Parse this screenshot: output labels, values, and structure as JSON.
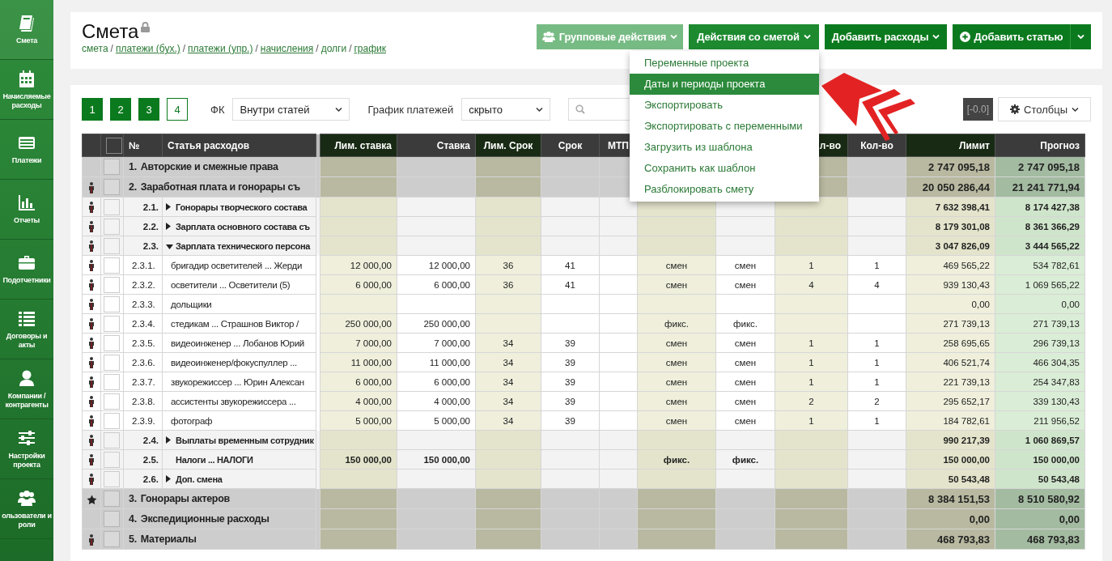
{
  "sidebar": {
    "items": [
      {
        "label": "Смета",
        "selected": true
      },
      {
        "label": "Начисляемые расходы",
        "selected": false
      },
      {
        "label": "Платежи",
        "selected": false
      },
      {
        "label": "Отчеты",
        "selected": false
      },
      {
        "label": "Подотчетники",
        "selected": false
      },
      {
        "label": "Договоры и акты",
        "selected": false
      },
      {
        "label": "Компании / контрагенты",
        "selected": false
      },
      {
        "label": "Настройки проекта",
        "selected": false
      },
      {
        "label": "ользователи и роли",
        "selected": false
      }
    ]
  },
  "header": {
    "title": "Смета",
    "locked": true,
    "breadcrumb": [
      {
        "kind": "crumb",
        "label": "смета",
        "link": false
      },
      {
        "kind": "separator",
        "label": "/"
      },
      {
        "kind": "crumb",
        "label": "платежи (бух.)",
        "link": true
      },
      {
        "kind": "separator",
        "label": "/"
      },
      {
        "kind": "crumb",
        "label": "платежи (упр.)",
        "link": true
      },
      {
        "kind": "separator",
        "label": "/"
      },
      {
        "kind": "crumb",
        "label": "начисления",
        "link": true
      },
      {
        "kind": "separator",
        "label": "/"
      },
      {
        "kind": "crumb",
        "label": "долги",
        "link": false
      },
      {
        "kind": "separator",
        "label": "/"
      },
      {
        "kind": "crumb",
        "label": "график",
        "link": true
      }
    ],
    "buttons": [
      {
        "label": "Групповые действия",
        "disabled": true,
        "open": false
      },
      {
        "label": "Действия со сметой",
        "disabled": false,
        "open": true
      },
      {
        "label": "Добавить расходы",
        "disabled": false,
        "open": false
      },
      {
        "label": "Добавить статью",
        "disabled": false,
        "open": false
      }
    ],
    "menu": [
      {
        "label": "Переменные проекта",
        "selected": false
      },
      {
        "label": "Даты и периоды проекта",
        "selected": true
      },
      {
        "label": "Экспортировать",
        "selected": false
      },
      {
        "label": "Экспортировать с переменными",
        "selected": false
      },
      {
        "label": "Загрузить из шаблона",
        "selected": false
      },
      {
        "label": "Сохранить как шаблон",
        "selected": false
      },
      {
        "label": "Разблокировать смету",
        "selected": false
      }
    ]
  },
  "toolbar": {
    "levels": [
      {
        "label": "1",
        "selected": true
      },
      {
        "label": "2",
        "selected": true
      },
      {
        "label": "3",
        "selected": true
      },
      {
        "label": "4",
        "selected": false
      }
    ],
    "fk_label": "ФК",
    "fk_value": "Внутри статей",
    "schedule_label": "График платежей",
    "schedule_value": "скрыто",
    "badge": "[-0.0]",
    "columns_button": "Столбцы"
  },
  "table": {
    "select_all_checked": false,
    "columns": {
      "num": "№",
      "name": "Статья расходов",
      "lim_rate": "Лим. ставка",
      "rate": "Ставка",
      "lim_term": "Лим. Срок",
      "term": "Срок",
      "mtp": "МТП",
      "column_10": "л-во",
      "qty": "Кол-во",
      "limit": "Лимит",
      "forecast": "Прогноз"
    },
    "rows": [
      {
        "kind": "group",
        "marker": {
          "kind": "none"
        },
        "checked": false,
        "num": "1.",
        "name": "Авторские и смежные права",
        "cells": {
          "limit": "2 747 095,18",
          "forecast": "2 747 095,18"
        }
      },
      {
        "kind": "group",
        "marker": {
          "kind": "person"
        },
        "checked": false,
        "num": "2.",
        "name": "Заработная плата и гонорары съ",
        "cells": {
          "limit": "20 050 286,44",
          "forecast": "21 241 771,94"
        }
      },
      {
        "kind": "subgroup",
        "marker": {
          "kind": "person"
        },
        "checked": false,
        "num": "2.1.",
        "expanded": false,
        "name": "Гонорары творческого состава",
        "cells": {
          "limit": "7 632 398,41",
          "forecast": "8 174 427,38"
        }
      },
      {
        "kind": "subgroup",
        "marker": {
          "kind": "person"
        },
        "checked": false,
        "num": "2.2.",
        "expanded": false,
        "name": "Зарплата основного состава съ",
        "cells": {
          "limit": "8 179 301,08",
          "forecast": "8 361 366,29"
        }
      },
      {
        "kind": "subgroup",
        "marker": {
          "kind": "person"
        },
        "checked": false,
        "num": "2.3.",
        "expanded": true,
        "name": "Зарплата технического персона",
        "cells": {
          "limit": "3 047 826,09",
          "forecast": "3 444 565,22"
        }
      },
      {
        "kind": "item",
        "marker": {
          "kind": "person"
        },
        "checked": false,
        "num": "2.3.1.",
        "name": "бригадир осветителей ... Жерди",
        "cells": {
          "lim_rate": "12 000,00",
          "rate": "12 000,00",
          "lim_term": "36",
          "term": "41",
          "column_8": "смен",
          "column_9": "смен",
          "column_10": "1",
          "qty": "1",
          "limit": "469 565,22",
          "forecast": "534 782,61"
        }
      },
      {
        "kind": "item",
        "marker": {
          "kind": "person"
        },
        "checked": false,
        "num": "2.3.2.",
        "name": "осветители ... Осветители (5)",
        "cells": {
          "lim_rate": "6 000,00",
          "rate": "6 000,00",
          "lim_term": "36",
          "term": "41",
          "column_8": "смен",
          "column_9": "смен",
          "column_10": "4",
          "qty": "4",
          "limit": "939 130,43",
          "forecast": "1 069 565,22"
        }
      },
      {
        "kind": "item",
        "marker": {
          "kind": "person"
        },
        "checked": false,
        "num": "2.3.3.",
        "name": "дольщики",
        "cells": {
          "limit": "0,00",
          "forecast": "0,00"
        }
      },
      {
        "kind": "item",
        "marker": {
          "kind": "person"
        },
        "checked": false,
        "num": "2.3.4.",
        "name": "стедикам ... Страшнов Виктор /",
        "cells": {
          "lim_rate": "250 000,00",
          "rate": "250 000,00",
          "column_8": "фикс.",
          "column_9": "фикс.",
          "limit": "271 739,13",
          "forecast": "271 739,13"
        }
      },
      {
        "kind": "item",
        "marker": {
          "kind": "person"
        },
        "checked": false,
        "num": "2.3.5.",
        "name": "видеоинженер ... Лобанов Юрий",
        "cells": {
          "lim_rate": "7 000,00",
          "rate": "7 000,00",
          "lim_term": "34",
          "term": "39",
          "column_8": "смен",
          "column_9": "смен",
          "column_10": "1",
          "qty": "1",
          "limit": "258 695,65",
          "forecast": "296 739,13"
        }
      },
      {
        "kind": "item",
        "marker": {
          "kind": "person"
        },
        "checked": false,
        "num": "2.3.6.",
        "name": "видеоинженер/фокуспуллер ...",
        "cells": {
          "lim_rate": "11 000,00",
          "rate": "11 000,00",
          "lim_term": "34",
          "term": "39",
          "column_8": "смен",
          "column_9": "смен",
          "column_10": "1",
          "qty": "1",
          "limit": "406 521,74",
          "forecast": "466 304,35"
        }
      },
      {
        "kind": "item",
        "marker": {
          "kind": "person"
        },
        "checked": false,
        "num": "2.3.7.",
        "name": "звукорежиссер ... Юрин Алексан",
        "cells": {
          "lim_rate": "6 000,00",
          "rate": "6 000,00",
          "lim_term": "34",
          "term": "39",
          "column_8": "смен",
          "column_9": "смен",
          "column_10": "1",
          "qty": "1",
          "limit": "221 739,13",
          "forecast": "254 347,83"
        }
      },
      {
        "kind": "item",
        "marker": {
          "kind": "person"
        },
        "checked": false,
        "num": "2.3.8.",
        "name": "ассистенты звукорежиссера ...",
        "cells": {
          "lim_rate": "4 000,00",
          "rate": "4 000,00",
          "lim_term": "34",
          "term": "39",
          "column_8": "смен",
          "column_9": "смен",
          "column_10": "2",
          "qty": "2",
          "limit": "295 652,17",
          "forecast": "339 130,43"
        }
      },
      {
        "kind": "item",
        "marker": {
          "kind": "person"
        },
        "checked": false,
        "num": "2.3.9.",
        "name": "фотограф",
        "cells": {
          "lim_rate": "5 000,00",
          "rate": "5 000,00",
          "lim_term": "34",
          "term": "39",
          "column_8": "смен",
          "column_9": "смен",
          "column_10": "1",
          "qty": "1",
          "limit": "184 782,61",
          "forecast": "211 956,52"
        }
      },
      {
        "kind": "subgroup",
        "marker": {
          "kind": "person"
        },
        "checked": false,
        "num": "2.4.",
        "expanded": false,
        "name": "Выплаты временным сотрудник",
        "cells": {
          "limit": "990 217,39",
          "forecast": "1 060 869,57"
        }
      },
      {
        "kind": "subgroup",
        "marker": {
          "kind": "person"
        },
        "checked": false,
        "num": "2.5.",
        "name": "Налоги ... НАЛОГИ",
        "cells": {
          "lim_rate": "150 000,00",
          "rate": "150 000,00",
          "column_8": "фикс.",
          "column_9": "фикс.",
          "limit": "150 000,00",
          "forecast": "150 000,00"
        }
      },
      {
        "kind": "subgroup",
        "marker": {
          "kind": "person"
        },
        "checked": false,
        "num": "2.6.",
        "expanded": false,
        "name": "Доп. смена",
        "cells": {
          "limit": "50 543,48",
          "forecast": "50 543,48"
        }
      },
      {
        "kind": "group",
        "marker": {
          "kind": "star"
        },
        "checked": false,
        "num": "3.",
        "name": "Гонорары актеров",
        "cells": {
          "limit": "8 384 151,53",
          "forecast": "8 510 580,92"
        }
      },
      {
        "kind": "group",
        "marker": {
          "kind": "none"
        },
        "checked": false,
        "num": "4.",
        "name": "Экспедиционные расходы",
        "cells": {
          "limit": "0,00",
          "forecast": "0,00"
        }
      },
      {
        "kind": "group",
        "marker": {
          "kind": "person"
        },
        "checked": false,
        "num": "5.",
        "name": "Материалы",
        "cells": {
          "limit": "468 793,83",
          "forecast": "468 793,83"
        }
      }
    ]
  }
}
